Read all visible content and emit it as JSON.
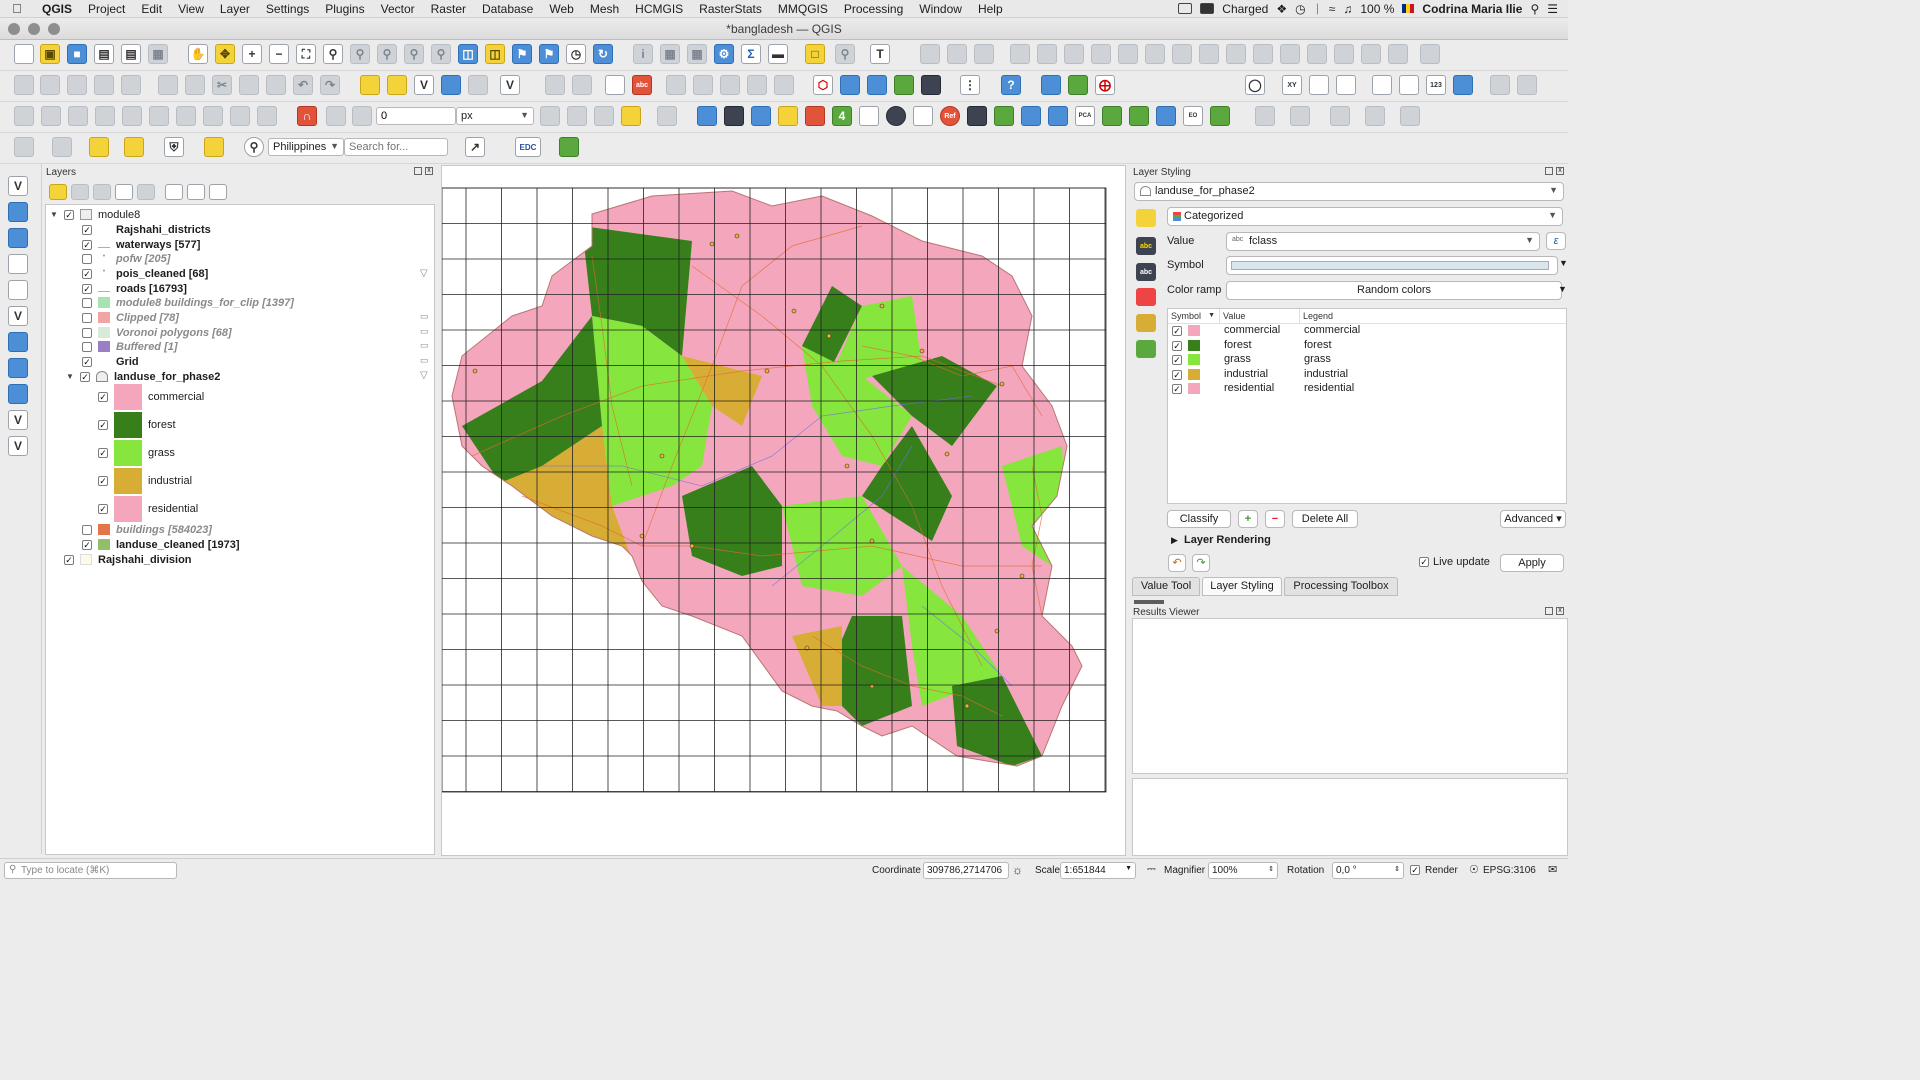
{
  "menubar": {
    "app": "QGIS",
    "items": [
      "Project",
      "Edit",
      "View",
      "Layer",
      "Settings",
      "Plugins",
      "Vector",
      "Raster",
      "Database",
      "Web",
      "Mesh",
      "HCMGIS",
      "RasterStats",
      "MMQGIS",
      "Processing",
      "Window",
      "Help"
    ],
    "battery_label": "Charged",
    "battery_pct": "100 %",
    "user": "Codrina Maria Ilie"
  },
  "window": {
    "title": "*bangladesh — QGIS"
  },
  "toolbar": {
    "stroke_value": "0",
    "unit": "px",
    "locator_country": "Philippines",
    "search_placeholder": "Search for...",
    "edc_label": "EDC"
  },
  "layers_panel": {
    "title": "Layers",
    "group": "module8",
    "layers": [
      {
        "name": "Rajshahi_districts",
        "checked": true,
        "style": "bold",
        "swatch": "#ffffff"
      },
      {
        "name": "waterways [577]",
        "checked": true,
        "style": "bold",
        "swatch": "line"
      },
      {
        "name": "pofw [205]",
        "checked": false,
        "style": "italic",
        "swatch": "dot"
      },
      {
        "name": "pois_cleaned [68]",
        "checked": true,
        "style": "bold",
        "swatch": "dot"
      },
      {
        "name": "roads [16793]",
        "checked": true,
        "style": "bold",
        "swatch": "line"
      },
      {
        "name": "module8 buildings_for_clip [1397]",
        "checked": false,
        "style": "italic",
        "swatch": "#a6e3b0"
      },
      {
        "name": "Clipped [78]",
        "checked": false,
        "style": "italic",
        "swatch": "#f0a4a4"
      },
      {
        "name": "Voronoi polygons [68]",
        "checked": false,
        "style": "italic",
        "swatch": "#d8ead8"
      },
      {
        "name": "Buffered [1]",
        "checked": false,
        "style": "italic",
        "swatch": "#9b7fc4"
      },
      {
        "name": "Grid",
        "checked": true,
        "style": "bold",
        "swatch": "#ffffff"
      }
    ],
    "landuse_group": "landuse_for_phase2",
    "categories": [
      {
        "label": "commercial",
        "color": "#f4a6bd"
      },
      {
        "label": "forest",
        "color": "#367f1a"
      },
      {
        "label": "grass",
        "color": "#86e63d"
      },
      {
        "label": "industrial",
        "color": "#d8ad36"
      },
      {
        "label": "residential",
        "color": "#f4a6bd"
      }
    ],
    "bottom_layers": [
      {
        "name": "buildings [584023]",
        "checked": false,
        "style": "italic",
        "swatch": "#e2764a"
      },
      {
        "name": "landuse_cleaned [1973]",
        "checked": true,
        "style": "bold",
        "swatch": "#8fbf6a"
      }
    ],
    "root_layer": "Rajshahi_division"
  },
  "styling": {
    "title": "Layer Styling",
    "layer": "landuse_for_phase2",
    "renderer": "Categorized",
    "value_label": "Value",
    "value_field": "fclass",
    "symbol_label": "Symbol",
    "color_ramp_label": "Color ramp",
    "color_ramp": "Random colors",
    "columns": [
      "Symbol",
      "Value",
      "Legend"
    ],
    "rows": [
      {
        "value": "commercial",
        "legend": "commercial",
        "color": "#f4a6bd"
      },
      {
        "value": "forest",
        "legend": "forest",
        "color": "#367f1a"
      },
      {
        "value": "grass",
        "legend": "grass",
        "color": "#86e63d"
      },
      {
        "value": "industrial",
        "legend": "industrial",
        "color": "#d8ad36"
      },
      {
        "value": "residential",
        "legend": "residential",
        "color": "#f4a6bd"
      }
    ],
    "classify": "Classify",
    "delete_all": "Delete All",
    "advanced": "Advanced",
    "layer_rendering": "Layer Rendering",
    "live_update": "Live update",
    "apply": "Apply"
  },
  "tabs": [
    "Value Tool",
    "Layer Styling",
    "Processing Toolbox"
  ],
  "results_title": "Results Viewer",
  "statusbar": {
    "locate_placeholder": "Type to locate (⌘K)",
    "coordinate_label": "Coordinate",
    "coordinate": "309786,2714706",
    "scale_label": "Scale",
    "scale": "1:651844",
    "magnifier_label": "Magnifier",
    "magnifier": "100%",
    "rotation_label": "Rotation",
    "rotation": "0,0 °",
    "render_label": "Render",
    "crs": "EPSG:3106"
  }
}
